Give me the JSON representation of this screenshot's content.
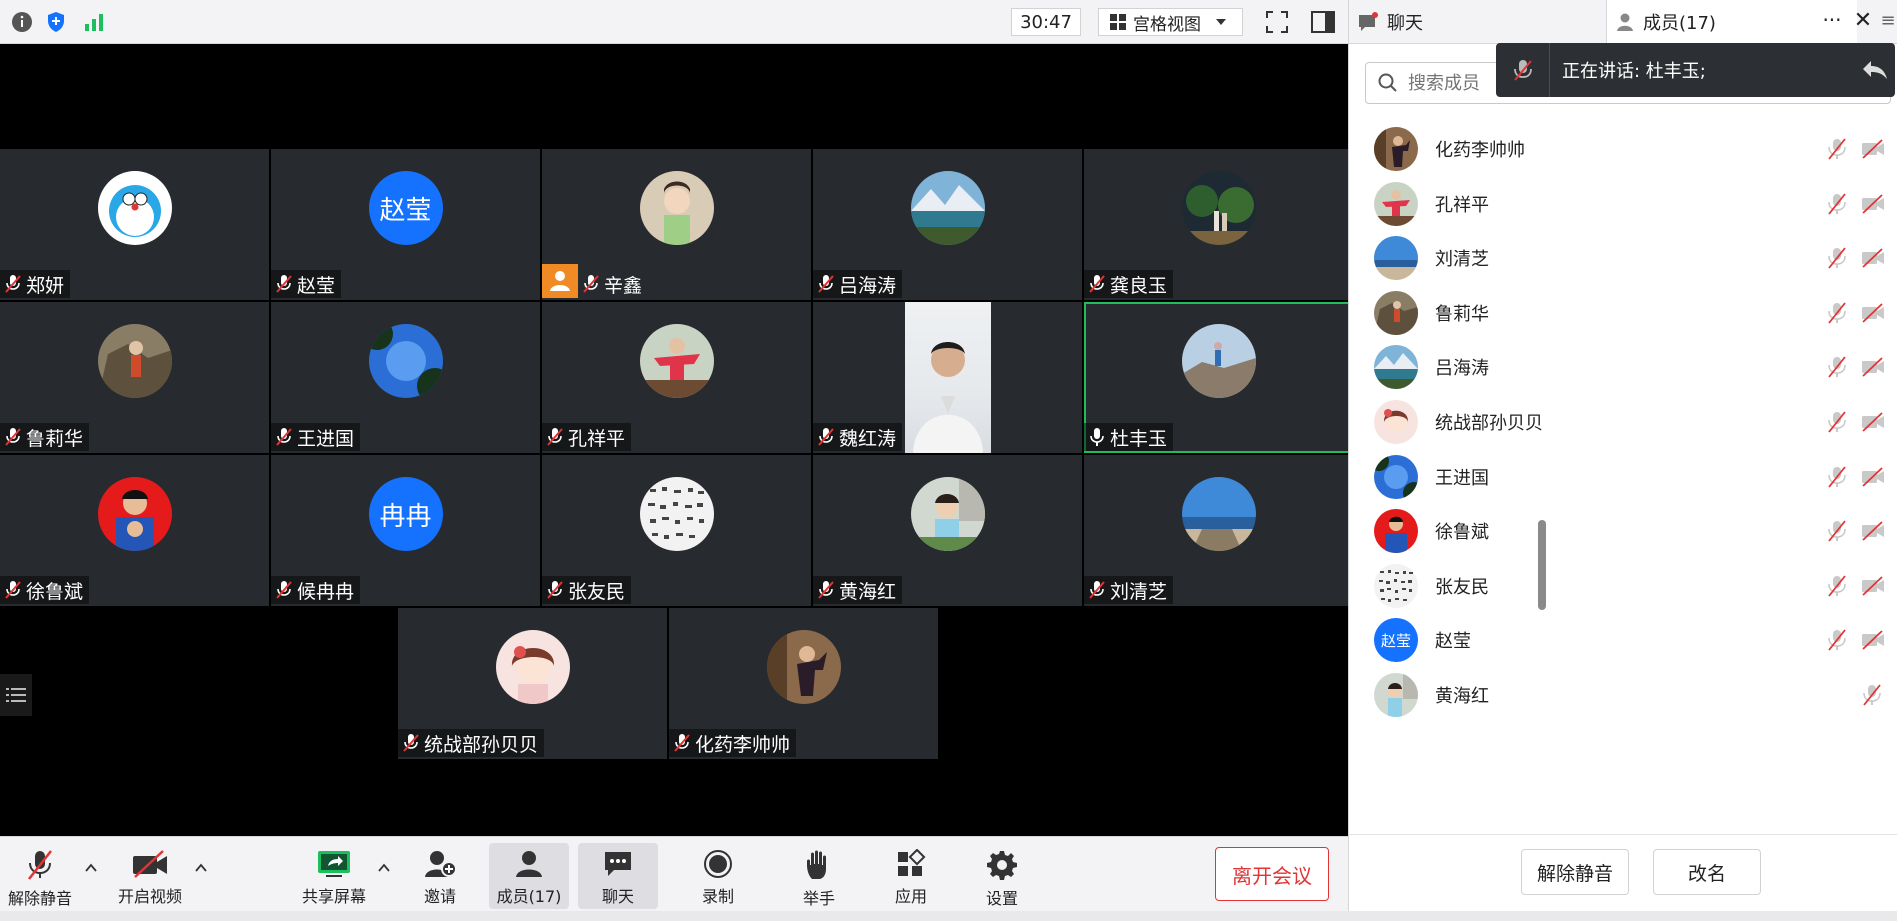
{
  "topbar": {
    "timer": "30:47",
    "view_mode": "宫格视图"
  },
  "tiles": [
    {
      "name": "郑妍",
      "avatar": "doraemon"
    },
    {
      "name": "赵莹",
      "avatar_text": "赵莹"
    },
    {
      "name": "辛鑫",
      "avatar": "child",
      "host": true
    },
    {
      "name": "吕海涛",
      "avatar": "lake"
    },
    {
      "name": "龚良玉",
      "avatar": "night-trees"
    },
    {
      "name": "鲁莉华",
      "avatar": "rock"
    },
    {
      "name": "王进国",
      "avatar": "sky-trees"
    },
    {
      "name": "孔祥平",
      "avatar": "man-red"
    },
    {
      "name": "魏红涛",
      "video": true
    },
    {
      "name": "杜丰玉",
      "avatar": "cliff",
      "speaking": true
    },
    {
      "name": "徐鲁斌",
      "avatar": "red-child"
    },
    {
      "name": "候冉冉",
      "avatar_text": "冉冉"
    },
    {
      "name": "张友民",
      "avatar": "calligraphy"
    },
    {
      "name": "黄海红",
      "avatar": "girl-green"
    },
    {
      "name": "刘清芝",
      "avatar": "sea"
    },
    {
      "name": "统战部孙贝贝",
      "avatar": "anime"
    },
    {
      "name": "化药李帅帅",
      "avatar": "man-pose"
    }
  ],
  "toolbar": {
    "unmute": "解除静音",
    "video": "开启视频",
    "share": "共享屏幕",
    "invite": "邀请",
    "members": "成员(17)",
    "chat": "聊天",
    "record": "录制",
    "raise_hand": "举手",
    "apps": "应用",
    "settings": "设置",
    "leave": "离开会议"
  },
  "panel": {
    "tab_chat": "聊天",
    "tab_members": "成员(17)",
    "more": "···",
    "close": "✕",
    "search_placeholder": "搜索成员",
    "speaking": "正在讲话: 杜丰玉;",
    "members": [
      {
        "name": "化药李帅帅",
        "avatar": "man-pose"
      },
      {
        "name": "孔祥平",
        "avatar": "man-red"
      },
      {
        "name": "刘清芝",
        "avatar": "sea"
      },
      {
        "name": "鲁莉华",
        "avatar": "rock"
      },
      {
        "name": "吕海涛",
        "avatar": "lake"
      },
      {
        "name": "统战部孙贝贝",
        "avatar": "anime"
      },
      {
        "name": "王进国",
        "avatar": "sky-trees"
      },
      {
        "name": "徐鲁斌",
        "avatar": "red-child"
      },
      {
        "name": "张友民",
        "avatar": "calligraphy"
      },
      {
        "name": "赵莹",
        "avatar_text": "赵莹"
      },
      {
        "name": "黄海红",
        "avatar": "girl-green",
        "no_cam": true
      }
    ],
    "unmute_btn": "解除静音",
    "rename_btn": "改名"
  },
  "colors": {
    "accent": "#1472ff",
    "speaking_border": "#1dbe5c",
    "leave": "#e23434",
    "muted_red": "#e23434",
    "host_badge": "#f08a24"
  }
}
